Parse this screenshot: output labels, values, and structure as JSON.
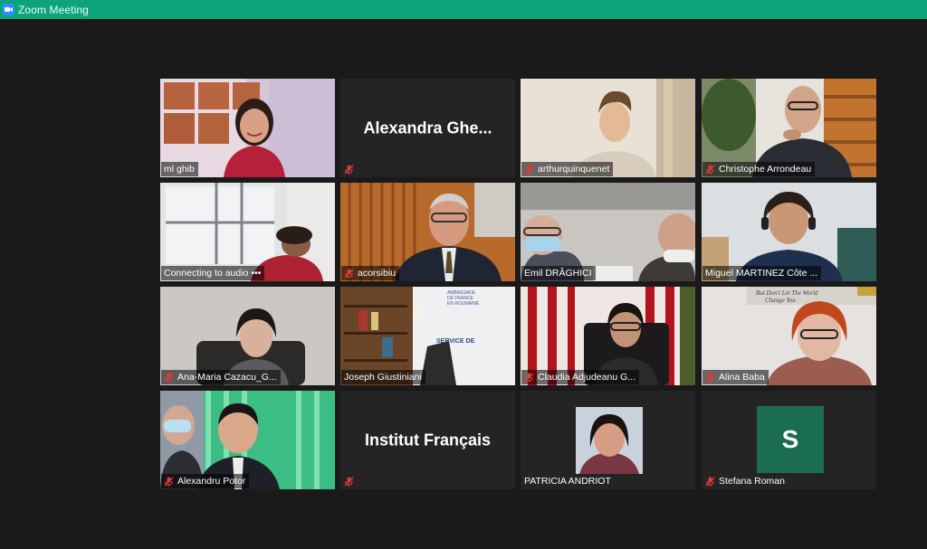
{
  "window": {
    "title": "Zoom Meeting",
    "accent": "#0ea47a"
  },
  "participants": [
    {
      "name": "ml ghib",
      "muted": false
    },
    {
      "name": "arthurquinquenet",
      "muted": true
    },
    {
      "name": "Christophe Arrondeau",
      "muted": true
    },
    {
      "name": "Connecting to audio",
      "status_suffix": "•••",
      "muted": false
    },
    {
      "name": "acorsibiu",
      "muted": true
    },
    {
      "name": "Emil DRĂGHICI",
      "muted": false,
      "active_speaker": true
    },
    {
      "name": "Miguel MARTINEZ Côte ...",
      "muted": false
    },
    {
      "name": "Ana-Maria Cazacu_G...",
      "muted": true
    },
    {
      "name": "Joseph Giustiniani",
      "muted": false
    },
    {
      "name": "Claudia Adjudeanu G...",
      "muted": true
    },
    {
      "name": "Alina Baba",
      "muted": true
    },
    {
      "name": "Alexandru Potor",
      "muted": true
    },
    {
      "name": "PATRICIA ANDRIOT",
      "muted": false
    },
    {
      "name": "Stefana Roman",
      "muted": true
    }
  ],
  "name_tiles": [
    {
      "display": "Alexandra  Ghe...",
      "muted": true
    },
    {
      "display": "Institut Français",
      "muted": true
    }
  ],
  "avatar": {
    "initial": "S",
    "color": "#1b6d4f"
  },
  "poster_text": {
    "line1": "AMBASSADE",
    "line2": "DE FRANCE",
    "line3": "EN ROUMANIE",
    "service": "SERVICE DE"
  }
}
